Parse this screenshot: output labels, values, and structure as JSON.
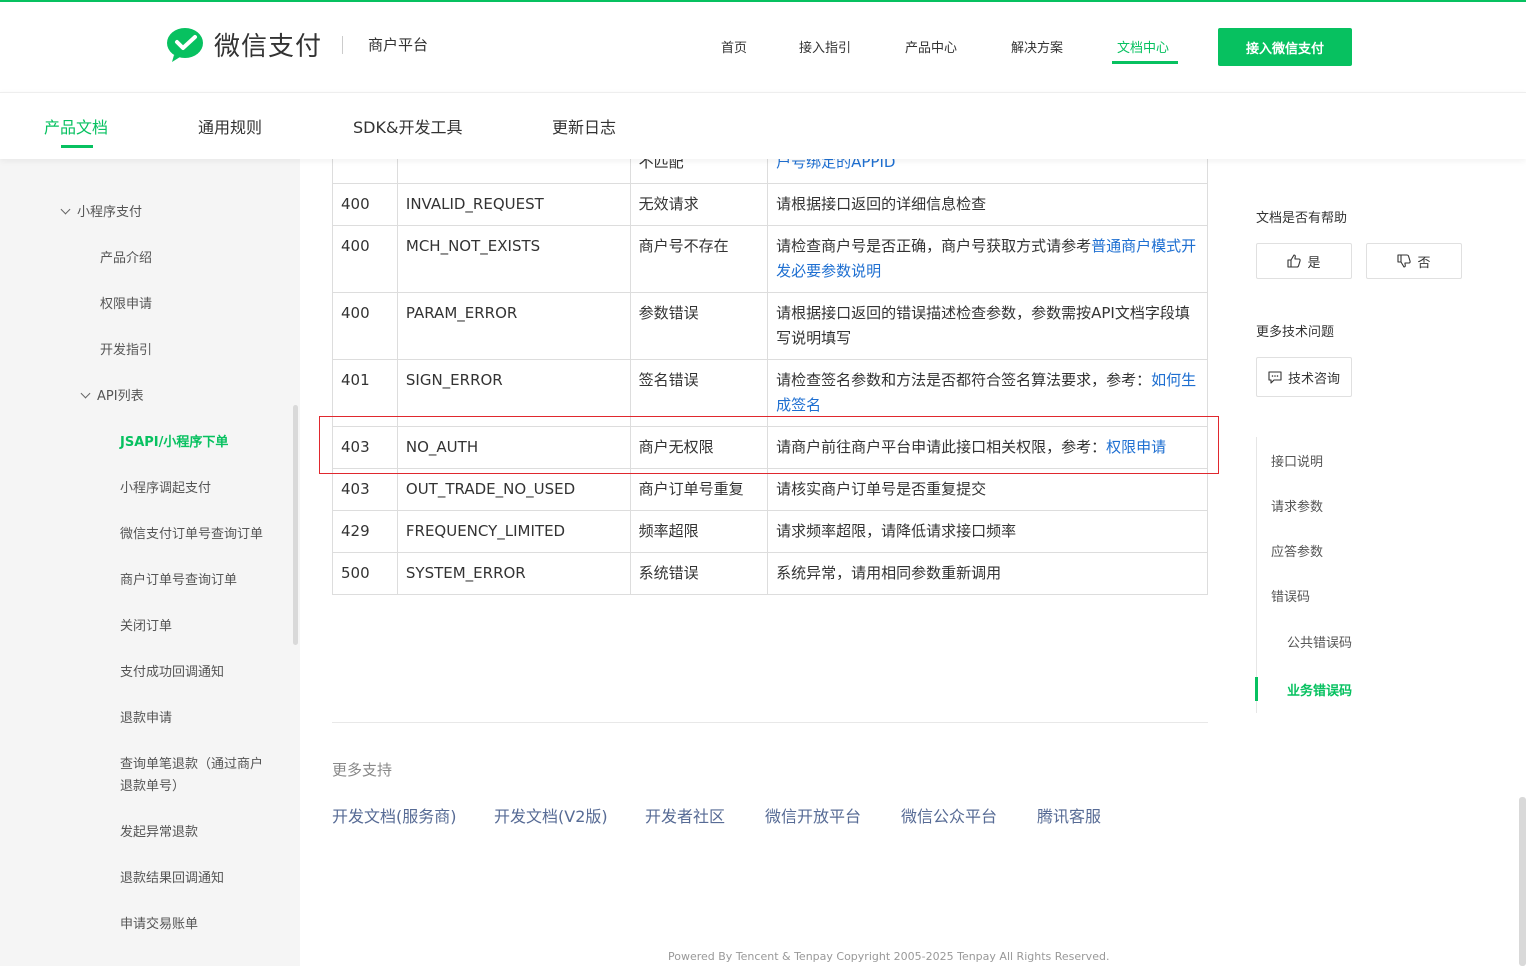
{
  "brand": {
    "name": "微信支付",
    "platform": "商户平台",
    "color": "#07c160"
  },
  "topnav": {
    "items": [
      "首页",
      "接入指引",
      "产品中心",
      "解决方案",
      "文档中心"
    ],
    "active": "文档中心",
    "cta": "接入微信支付"
  },
  "subnav": {
    "items": [
      "产品文档",
      "通用规则",
      "SDK&开发工具",
      "更新日志"
    ],
    "active": "产品文档"
  },
  "sidebar": {
    "items": [
      "小程序支付",
      "产品介绍",
      "权限申请",
      "开发指引",
      "API列表",
      "JSAPI/小程序下单",
      "小程序调起支付",
      "微信支付订单号查询订单",
      "商户订单号查询订单",
      "关闭订单",
      "支付成功回调通知",
      "退款申请",
      "查询单笔退款（通过商户",
      "退款单号）",
      "发起异常退款",
      "退款结果回调通知",
      "申请交易账单"
    ],
    "active": "JSAPI/小程序下单"
  },
  "table": {
    "partial_row": {
      "desc": "不匹配",
      "solution_link": "户号绑定的APPID"
    },
    "rows": [
      {
        "code": "400",
        "name": "INVALID_REQUEST",
        "desc": "无效请求",
        "solution": "请根据接口返回的详细信息检查",
        "link": ""
      },
      {
        "code": "400",
        "name": "MCH_NOT_EXISTS",
        "desc": "商户号不存在",
        "solution": "请检查商户号是否正确，商户号获取方式请参考",
        "link": "普通商户模式开发必要参数说明"
      },
      {
        "code": "400",
        "name": "PARAM_ERROR",
        "desc": "参数错误",
        "solution": "请根据接口返回的错误描述检查参数，参数需按API文档字段填写说明填写",
        "link": ""
      },
      {
        "code": "401",
        "name": "SIGN_ERROR",
        "desc": "签名错误",
        "solution": "请检查签名参数和方法是否都符合签名算法要求，参考：",
        "link": "如何生成签名"
      },
      {
        "code": "403",
        "name": "NO_AUTH",
        "desc": "商户无权限",
        "solution": "请商户前往商户平台申请此接口相关权限，参考：",
        "link": "权限申请"
      },
      {
        "code": "403",
        "name": "OUT_TRADE_NO_USED",
        "desc": "商户订单号重复",
        "solution": "请核实商户订单号是否重复提交",
        "link": ""
      },
      {
        "code": "429",
        "name": "FREQUENCY_LIMITED",
        "desc": "频率超限",
        "solution": "请求频率超限，请降低请求接口频率",
        "link": ""
      },
      {
        "code": "500",
        "name": "SYSTEM_ERROR",
        "desc": "系统错误",
        "solution": "系统异常，请用相同参数重新调用",
        "link": ""
      }
    ]
  },
  "more_support": {
    "title": "更多支持",
    "links": [
      "开发文档(服务商)",
      "开发文档(V2版)",
      "开发者社区",
      "微信开放平台",
      "微信公众平台",
      "腾讯客服"
    ]
  },
  "feedback": {
    "title": "文档是否有帮助",
    "yes": "是",
    "no": "否",
    "more_title": "更多技术问题",
    "consult": "技术咨询"
  },
  "toc": {
    "items": [
      "接口说明",
      "请求参数",
      "应答参数",
      "错误码",
      "公共错误码",
      "业务错误码"
    ],
    "active": "业务错误码"
  },
  "footer": "Powered By Tencent & Tenpay Copyright 2005-2025 Tenpay All Rights Reserved.",
  "highlight_color": "#e0282e",
  "link_color": "#1e6fd1"
}
